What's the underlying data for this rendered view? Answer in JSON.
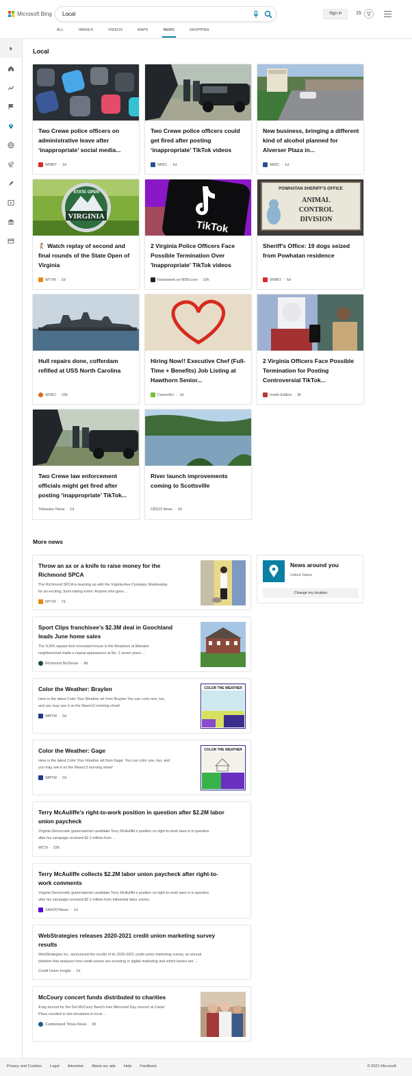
{
  "header": {
    "logo_text": "Microsoft Bing",
    "search_value": "Local",
    "sign_in": "Sign in",
    "rewards_points": "15"
  },
  "tabs": [
    "ALL",
    "IMAGES",
    "VIDEOS",
    "MAPS",
    "NEWS",
    "SHOPPING"
  ],
  "active_tab": "NEWS",
  "section_local": "Local",
  "cards": [
    {
      "title": "Two Crewe police officers on administrative leave after ‘inappropriate’ social media...",
      "source": "WWBT",
      "time": "1d"
    },
    {
      "title": "Two Crewe police officers could get fired after posting ‘inappropriate’ TikTok videos",
      "source": "WRIC",
      "time": "1d"
    },
    {
      "title": "New business, bringing a different kind of alcohol planned for Alverser Plaza in...",
      "source": "WRIC",
      "time": "1d"
    },
    {
      "title": "🏌️ Watch replay of second and final rounds of the State Open of Virginia",
      "source": "WTVR",
      "time": "2d"
    },
    {
      "title": "2 Virginia Police Officers Face Possible Termination Over 'Inappropriate' TikTok videos",
      "source": "Newsweek on MSN.com",
      "time": "19h"
    },
    {
      "title": "Sheriff's Office: 19 dogs seized from Powhatan residence",
      "source": "WWBT",
      "time": "6d"
    },
    {
      "title": "Hull repairs done, cofferdam refilled at USS North Carolina",
      "source": "WVEC",
      "time": "23h"
    },
    {
      "title": "Hiring Now!! Executive Chef (Full-Time + Benefits) Job Listing at Hawthorn Senior...",
      "source": "CareerArc",
      "time": "1d"
    },
    {
      "title": "2 Virginia Officers Face Possible Termination for Posting Controversial TikTok...",
      "source": "Inside Edition",
      "time": "3h"
    },
    {
      "title": "Two Crewe law enforcement officials might get fired after posting ‘inappropriate’ TikTok...",
      "source": "Tidewater News",
      "time": "1d"
    },
    {
      "title": "River launch improvements coming to Scottsville",
      "source": "CBS19 News",
      "time": "2d"
    }
  ],
  "image_text": {
    "golf_badge_top": "STATE OPEN",
    "golf_badge_main": "VIRGINIA",
    "tiktok_word": "TikTok",
    "sign_line1": "POWHATAN SHERIFF'S OFFICE",
    "sign_line2": "ANIMAL",
    "sign_line3": "CONTROL",
    "sign_line4": "DIVISION",
    "weather_header": "COLOR THE WEATHER"
  },
  "section_more": "More news",
  "more": [
    {
      "title_lines": [
        "Throw an ax or a knife to raise money for the",
        "Richmond SPCA"
      ],
      "desc_lines": [
        "The Richmond SPCA is teaming up with the Virginia Axe Company Wednesday",
        "for an exciting, fund-raising event. Anyone who goes ..."
      ],
      "source": "WTVR",
      "time": "7d"
    },
    {
      "title_lines": [
        "Sport Clips franchisee’s $2.3M deal in Goochland",
        "leads June home sales"
      ],
      "desc_lines": [
        "The 9,300-square-foot renovated house in the Meadows at Manakin",
        "neighborhood made a repeat appearance at No. 1 seven years ..."
      ],
      "source": "Richmond BizSense",
      "time": "8d"
    },
    {
      "title_lines": [
        "Color the Weather: Braylen"
      ],
      "desc_lines": [
        "Here is the latest Color Your Weather art from Braylen You can color one, too,",
        "and you may see it on the News13 morning show!"
      ],
      "source": "WBTW",
      "time": "2d"
    },
    {
      "title_lines": [
        "Color the Weather: Gage"
      ],
      "desc_lines": [
        "Here is the latest Color Your Weather art from Gage. You can color one, too, and",
        "you may see it on the News13 morning show!"
      ],
      "source": "WBTW",
      "time": "2d"
    },
    {
      "title_lines": [
        "Terry McAuliffe’s right-to-work position in question after $2.2M labor",
        "union paycheck"
      ],
      "desc_lines": [
        "Virginia Democratic gubernatorial candidate Terry McAuliffe’s position on right-to-work laws is in question",
        "after his campaign received $2.2 million from ..."
      ],
      "source": "WCSI",
      "time": "23h"
    },
    {
      "title_lines": [
        "Terry McAuliffe collects $2.2M labor union paycheck after right-to-",
        "work comments"
      ],
      "desc_lines": [
        "Virginia Democratic gubernatorial candidate Terry McAuliffe’s position on right-to-work laws is in question",
        "after his campaign received $2.2 million from influential labor unions."
      ],
      "source": "YAHOO!News",
      "time": "1d"
    },
    {
      "title_lines": [
        "WebStrategies releases 2020-2021 credit union marketing survey",
        "results"
      ],
      "desc_lines": [
        "WebStrategies Inc. announced the results of its 2020-2021 credit union marketing survey, an annual",
        "initiative that analyzes how credit unions are investing in digital marketing and which tactics are ..."
      ],
      "source": "Credit Union Insight",
      "time": "1d"
    },
    {
      "title_lines": [
        "McCoury concert funds distributed to charities"
      ],
      "desc_lines": [
        "A big turnout for the Del McCoury Band's free Memorial Day concert at Canal",
        "Place resulted in two donations to local ..."
      ],
      "source": "Cumberland Times-News",
      "time": "3d"
    }
  ],
  "around": {
    "title": "News around you",
    "location": "United States",
    "button": "Change my location"
  },
  "footer": {
    "links": [
      "Privacy and Cookies",
      "Legal",
      "Advertise",
      "About our ads",
      "Help",
      "Feedback"
    ],
    "copyright": "© 2021 Microsoft"
  },
  "colors": {
    "accent": "#00809d",
    "pin_bg": "#0a7fa3"
  }
}
